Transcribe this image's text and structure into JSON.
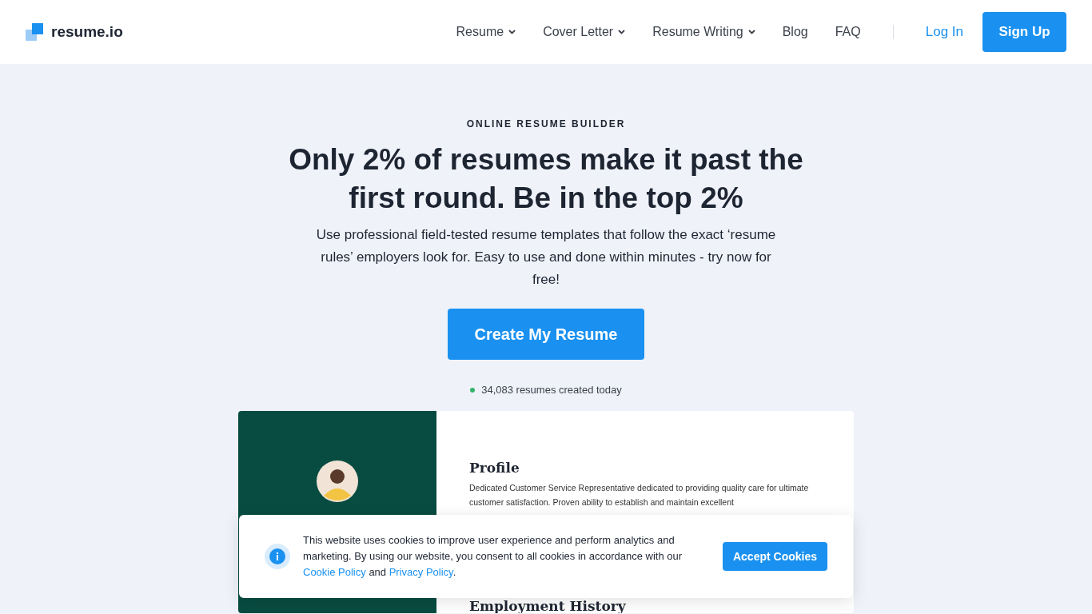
{
  "header": {
    "logo": "resume.io",
    "nav": [
      {
        "label": "Resume",
        "dropdown": true
      },
      {
        "label": "Cover Letter",
        "dropdown": true
      },
      {
        "label": "Resume Writing",
        "dropdown": true
      },
      {
        "label": "Blog",
        "dropdown": false
      },
      {
        "label": "FAQ",
        "dropdown": false
      }
    ],
    "login": "Log In",
    "signup": "Sign Up"
  },
  "hero": {
    "eyebrow": "ONLINE RESUME BUILDER",
    "title": "Only 2% of resumes make it past the first round. Be in the top 2%",
    "subtitle": "Use professional field-tested resume templates that follow the exact ‘resume rules’ employers look for. Easy to use and done within minutes - try now for free!",
    "cta": "Create My Resume",
    "stat": "34,083 resumes created today"
  },
  "resume_preview": {
    "sections": [
      {
        "heading": "Profile",
        "body": "Dedicated Customer Service Representative dedicated to providing quality care for ultimate customer satisfaction. Proven ability to establish and maintain excellent"
      },
      {
        "heading": "Employment History"
      }
    ]
  },
  "cookie_banner": {
    "parts": [
      {
        "kind": "text",
        "text": "This website uses cookies to improve user experience and perform analytics and marketing. By using our website, you consent to all cookies in accordance with our "
      },
      {
        "kind": "link",
        "text": "Cookie Policy"
      },
      {
        "kind": "text",
        "text": " and "
      },
      {
        "kind": "link",
        "text": "Privacy Policy"
      },
      {
        "kind": "text",
        "text": "."
      }
    ],
    "button": "Accept Cookies"
  }
}
